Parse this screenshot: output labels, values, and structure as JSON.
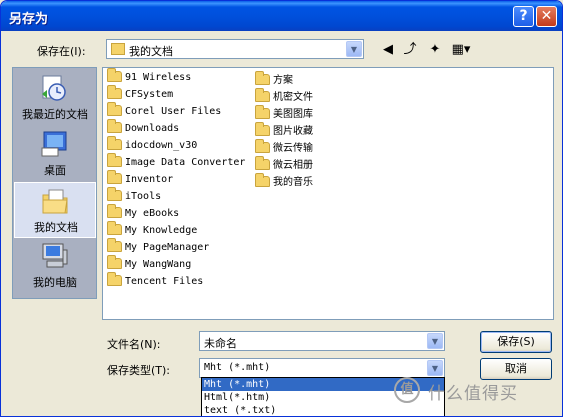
{
  "window": {
    "title": "另存为",
    "help_label": "?",
    "close_label": "✕"
  },
  "save_in": {
    "label": "保存在(I):",
    "value": "我的文档"
  },
  "toolbar": [
    {
      "name": "back-icon",
      "glyph": "◀"
    },
    {
      "name": "up-folder-icon",
      "glyph": "⤴"
    },
    {
      "name": "new-folder-icon",
      "glyph": "✦"
    },
    {
      "name": "view-menu-icon",
      "glyph": "▦▾"
    }
  ],
  "places": [
    {
      "label": "我最近的文档",
      "icon": "recent-documents-icon"
    },
    {
      "label": "桌面",
      "icon": "desktop-icon"
    },
    {
      "label": "我的文档",
      "icon": "my-documents-icon",
      "active": true
    },
    {
      "label": "我的电脑",
      "icon": "my-computer-icon"
    }
  ],
  "files_col1": [
    "91 Wireless",
    "CFSystem",
    "Corel User Files",
    "Downloads",
    "idocdown_v30",
    "Image Data Converter",
    "Inventor",
    "iTools",
    "My eBooks",
    "My Knowledge",
    "My PageManager",
    "My WangWang",
    "Tencent Files"
  ],
  "files_col2": [
    {
      "name": "方案",
      "icon": "folder"
    },
    {
      "name": "机密文件",
      "icon": "folder"
    },
    {
      "name": "美图图库",
      "icon": "folder"
    },
    {
      "name": "图片收藏",
      "icon": "pictures-folder-icon"
    },
    {
      "name": "微云传输",
      "icon": "folder"
    },
    {
      "name": "微云相册",
      "icon": "folder"
    },
    {
      "name": "我的音乐",
      "icon": "music-folder-icon"
    }
  ],
  "filename": {
    "label": "文件名(N):",
    "value": "未命名"
  },
  "filetype": {
    "label": "保存类型(T):",
    "value": "Mht (*.mht)",
    "options": [
      "Mht (*.mht)",
      "Html(*.htm)",
      "text (*.txt)"
    ],
    "selected_index": 0
  },
  "buttons": {
    "save": "保存(S)",
    "cancel": "取消"
  },
  "watermark": {
    "text": "什么值得买",
    "badge": "值"
  }
}
